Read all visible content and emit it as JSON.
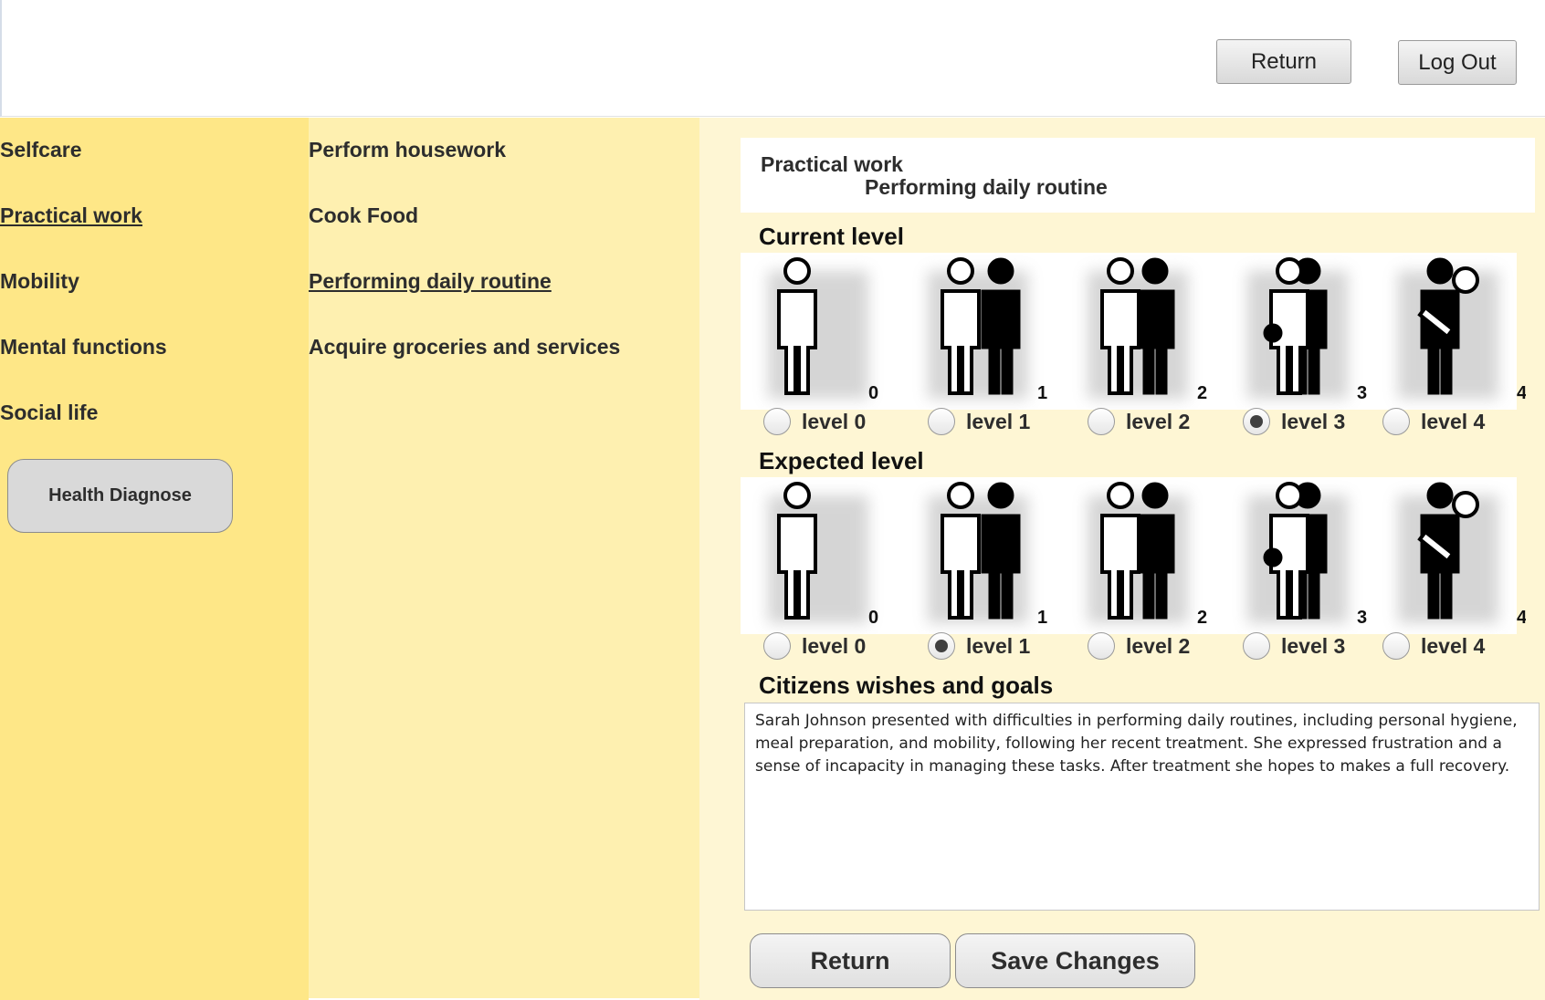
{
  "header": {
    "return_label": "Return",
    "logout_label": "Log Out"
  },
  "categories": [
    {
      "label": "Selfcare",
      "active": false
    },
    {
      "label": "Practical work",
      "active": true
    },
    {
      "label": "Mobility",
      "active": false
    },
    {
      "label": "Mental functions",
      "active": false
    },
    {
      "label": "Social life",
      "active": false
    }
  ],
  "health_button_label": "Health Diagnose",
  "subcategories": [
    {
      "label": "Perform housework",
      "active": false
    },
    {
      "label": "Cook Food",
      "active": false
    },
    {
      "label": "Performing daily routine",
      "active": true
    },
    {
      "label": "Acquire groceries and services",
      "active": false
    }
  ],
  "detail": {
    "category_title": "Practical work",
    "subcategory_title": "Performing daily routine",
    "current_level_heading": "Current level",
    "expected_level_heading": "Expected level",
    "wishes_heading": "Citizens wishes and goals",
    "wishes_text": "Sarah Johnson presented with difficulties in performing daily routines, including personal hygiene, meal preparation, and mobility, following her recent treatment. She expressed frustration and a sense of incapacity in managing these tasks. After treatment she hopes to makes a full recovery."
  },
  "level_labels": [
    "level 0",
    "level 1",
    "level 2",
    "level 3",
    "level 4"
  ],
  "level_numbers": [
    "0",
    "1",
    "2",
    "3",
    "4"
  ],
  "current_level": 3,
  "expected_level": 1,
  "footer": {
    "return_label": "Return",
    "save_label": "Save Changes"
  }
}
